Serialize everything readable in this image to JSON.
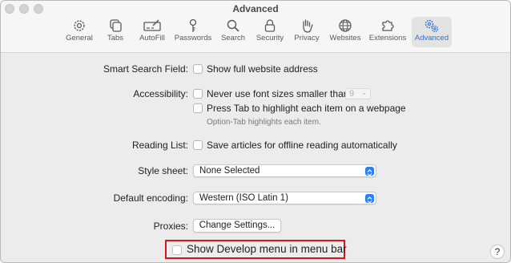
{
  "window": {
    "title": "Advanced"
  },
  "toolbar": {
    "tabs": [
      {
        "label": "General",
        "icon": "gear-icon"
      },
      {
        "label": "Tabs",
        "icon": "tabs-icon"
      },
      {
        "label": "AutoFill",
        "icon": "autofill-icon"
      },
      {
        "label": "Passwords",
        "icon": "key-icon"
      },
      {
        "label": "Search",
        "icon": "search-icon"
      },
      {
        "label": "Security",
        "icon": "lock-icon"
      },
      {
        "label": "Privacy",
        "icon": "hand-icon"
      },
      {
        "label": "Websites",
        "icon": "globe-icon"
      },
      {
        "label": "Extensions",
        "icon": "puzzle-icon"
      },
      {
        "label": "Advanced",
        "icon": "gears-icon"
      }
    ],
    "active_tab": "Advanced",
    "accent": "#2b70d8"
  },
  "settings": {
    "smart_search": {
      "label": "Smart Search Field:",
      "option": "Show full website address",
      "checked": false
    },
    "accessibility": {
      "label": "Accessibility:",
      "font_option": "Never use font sizes smaller than",
      "font_size": "9",
      "tab_option": "Press Tab to highlight each item on a webpage",
      "note": "Option-Tab highlights each item."
    },
    "reading_list": {
      "label": "Reading List:",
      "option": "Save articles for offline reading automatically"
    },
    "style_sheet": {
      "label": "Style sheet:",
      "value": "None Selected"
    },
    "encoding": {
      "label": "Default encoding:",
      "value": "Western (ISO Latin 1)"
    },
    "proxies": {
      "label": "Proxies:",
      "button": "Change Settings..."
    },
    "develop": {
      "option": "Show Develop menu in menu bar",
      "checked": false,
      "highlight_color": "#d9141b"
    }
  },
  "help": {
    "symbol": "?"
  }
}
